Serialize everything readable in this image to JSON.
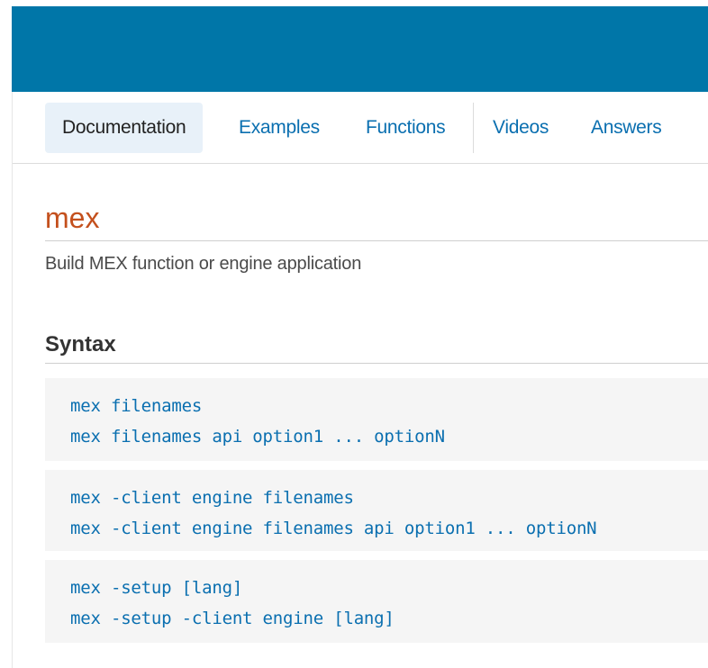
{
  "colors": {
    "banner": "#0076a8",
    "link": "#0a6fb0",
    "title": "#c4501d"
  },
  "nav": {
    "tabs": [
      {
        "label": "Documentation",
        "active": true
      },
      {
        "label": "Examples",
        "active": false
      },
      {
        "label": "Functions",
        "active": false
      },
      {
        "label": "Videos",
        "active": false
      },
      {
        "label": "Answers",
        "active": false
      }
    ]
  },
  "page": {
    "title": "mex",
    "subtitle": "Build MEX function or engine application"
  },
  "syntax": {
    "heading": "Syntax",
    "blocks": [
      {
        "lines": [
          "mex filenames",
          "mex filenames api option1 ... optionN"
        ]
      },
      {
        "lines": [
          "mex -client engine filenames",
          "mex -client engine filenames api option1 ... optionN"
        ]
      },
      {
        "lines": [
          "mex -setup [lang]",
          "mex -setup -client engine [lang]"
        ]
      }
    ]
  }
}
